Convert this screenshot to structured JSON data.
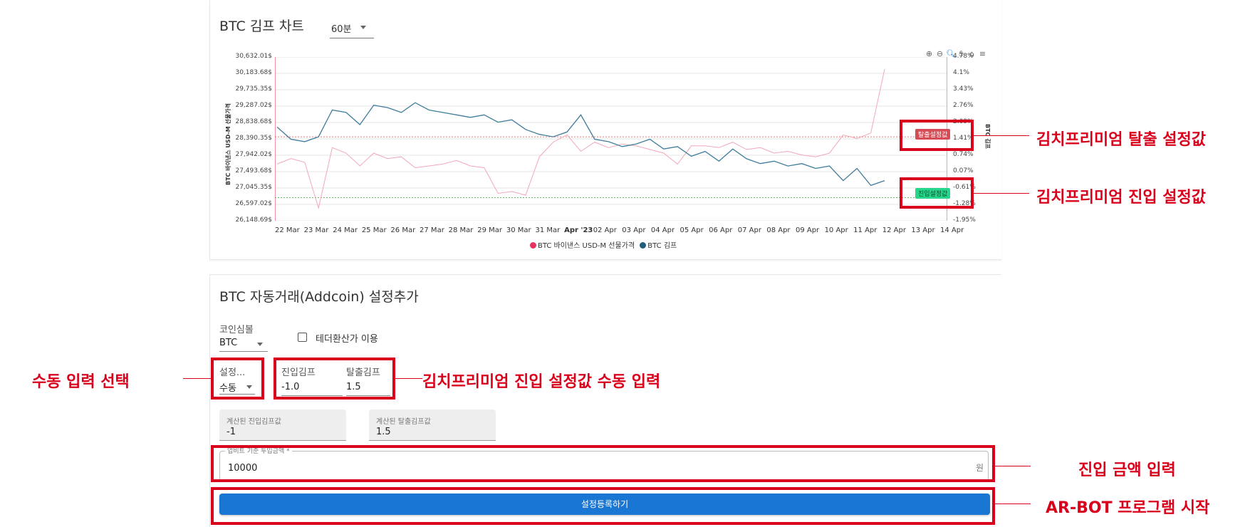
{
  "chart_card": {
    "title": "BTC 김프 차트",
    "interval_select": "60분"
  },
  "chart_data": {
    "type": "line",
    "left_axis_label": "BTC 바이낸스 USD-M 선물가격",
    "right_axis_label": "BTC 김프",
    "left_ticks": [
      "30,632.01$",
      "30,183.68$",
      "29,735.35$",
      "29,287.02$",
      "28,838.68$",
      "28,390.35$",
      "27,942.02$",
      "27,493.68$",
      "27,045.35$",
      "26,597.02$",
      "26,148.69$"
    ],
    "right_ticks": [
      "4.78%",
      "4.1%",
      "3.43%",
      "2.76%",
      "2.09%",
      "1.41%",
      "0.74%",
      "0.07%",
      "-0.61%",
      "-1.28%",
      "-1.95%"
    ],
    "x_ticks": [
      "22 Mar",
      "23 Mar",
      "24 Mar",
      "25 Mar",
      "26 Mar",
      "27 Mar",
      "28 Mar",
      "29 Mar",
      "30 Mar",
      "31 Mar",
      "Apr '23",
      "02 Apr",
      "03 Apr",
      "04 Apr",
      "05 Apr",
      "06 Apr",
      "07 Apr",
      "08 Apr",
      "09 Apr",
      "10 Apr",
      "11 Apr",
      "12 Apr",
      "13 Apr",
      "14 Apr"
    ],
    "ylim_left": [
      26148.69,
      30632.01
    ],
    "ylim_right": [
      -1.95,
      4.78
    ],
    "exit_line_label": "탈출설정값",
    "entry_line_label": "진입설정값",
    "exit_value": 1.5,
    "entry_value": -1.0,
    "series": [
      {
        "name": "BTC 바이낸스 USD-M 선물가격",
        "color": "#f2a7b8",
        "axis": "left",
        "values": [
          27700,
          27850,
          27750,
          26500,
          28150,
          28000,
          27650,
          28000,
          27850,
          27900,
          27600,
          27650,
          27700,
          27800,
          27650,
          27600,
          26900,
          26950,
          26850,
          27900,
          28300,
          28500,
          28050,
          28300,
          28150,
          28250,
          28200,
          28100,
          28000,
          27700,
          28200,
          28200,
          28150,
          28300,
          28100,
          28150,
          28000,
          28050,
          27950,
          27900,
          28000,
          28500,
          28400,
          28550,
          30300
        ]
      },
      {
        "name": "BTC 김프",
        "color": "#3f7d9b",
        "axis": "right",
        "values": [
          1.9,
          1.4,
          1.3,
          1.5,
          2.6,
          2.5,
          2.0,
          2.8,
          2.7,
          2.5,
          2.9,
          2.6,
          2.5,
          2.4,
          2.3,
          2.4,
          2.1,
          2.2,
          1.8,
          1.6,
          1.5,
          1.7,
          2.4,
          1.4,
          1.3,
          1.1,
          1.2,
          1.4,
          1.0,
          1.1,
          0.7,
          0.9,
          0.5,
          1.0,
          0.6,
          0.4,
          0.5,
          0.3,
          0.4,
          0.2,
          0.3,
          -0.3,
          0.2,
          -0.5,
          -0.3
        ]
      }
    ]
  },
  "settings_card": {
    "title": "BTC 자동거래(Addcoin) 설정추가",
    "coin_symbol_label": "코인심볼",
    "coin_symbol_value": "BTC",
    "tether_checkbox_label": "테더환산가 이용",
    "mode_label": "설정...",
    "mode_value": "수동",
    "entry_kimp_label": "진입김프",
    "entry_kimp_value": "-1.0",
    "exit_kimp_label": "탈출김프",
    "exit_kimp_value": "1.5",
    "calc_entry_label": "계산된 진입김프값",
    "calc_entry_value": "-1",
    "calc_exit_label": "계산된 탈출김프값",
    "calc_exit_value": "1.5",
    "amount_label": "업비트 기준 투입금액 *",
    "amount_value": "10000",
    "amount_unit": "원",
    "submit_label": "설정등록하기"
  },
  "annotations": {
    "exit_setting": "김치프리미엄 탈출 설정값",
    "entry_setting": "김치프리미엄 진입 설정값",
    "manual_select": "수동 입력 선택",
    "manual_entry_input": "김치프리미엄 진입 설정값 수동 입력",
    "amount_input": "진입 금액 입력",
    "start_program": "AR-BOT 프로그램 시작"
  },
  "colors": {
    "annotation_red": "#d9001b",
    "primary_blue": "#1976d2",
    "exit_badge": "#d64b55",
    "entry_badge": "#26d68a"
  }
}
